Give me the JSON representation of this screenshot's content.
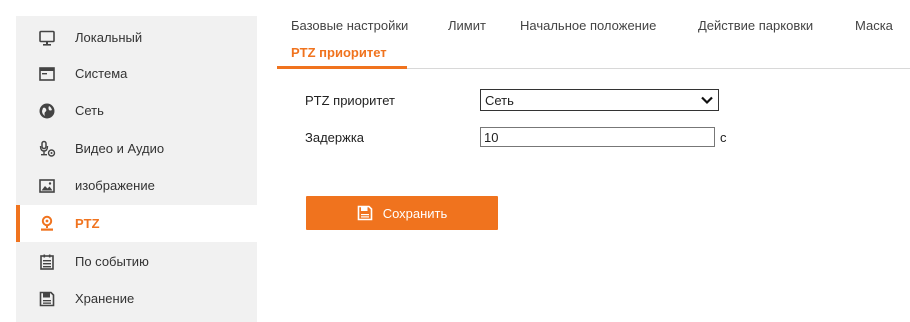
{
  "sidebar": {
    "items": [
      {
        "label": "Локальный",
        "icon": "monitor-icon"
      },
      {
        "label": "Система",
        "icon": "system-window-icon"
      },
      {
        "label": "Сеть",
        "icon": "globe-icon"
      },
      {
        "label": "Видео и Аудио",
        "icon": "microphone-camera-icon"
      },
      {
        "label": "изображение",
        "icon": "image-icon"
      },
      {
        "label": "PTZ",
        "icon": "ptz-camera-icon",
        "active": true
      },
      {
        "label": "По событию",
        "icon": "calendar-icon"
      },
      {
        "label": "Хранение",
        "icon": "storage-disk-icon"
      }
    ]
  },
  "tabs": [
    {
      "label": "Базовые настройки"
    },
    {
      "label": "Лимит"
    },
    {
      "label": "Начальное положение"
    },
    {
      "label": "Действие парковки"
    },
    {
      "label": "Маска"
    },
    {
      "label": "PTZ приоритет",
      "active": true
    }
  ],
  "form": {
    "priority_label": "PTZ приоритет",
    "priority_value": "Сеть",
    "delay_label": "Задержка",
    "delay_value": "10",
    "delay_unit": "с"
  },
  "actions": {
    "save_label": "Сохранить",
    "save_icon": "floppy-disk-icon"
  },
  "colors": {
    "accent": "#f0731e",
    "sidebar_bg": "#f1f1f1"
  }
}
